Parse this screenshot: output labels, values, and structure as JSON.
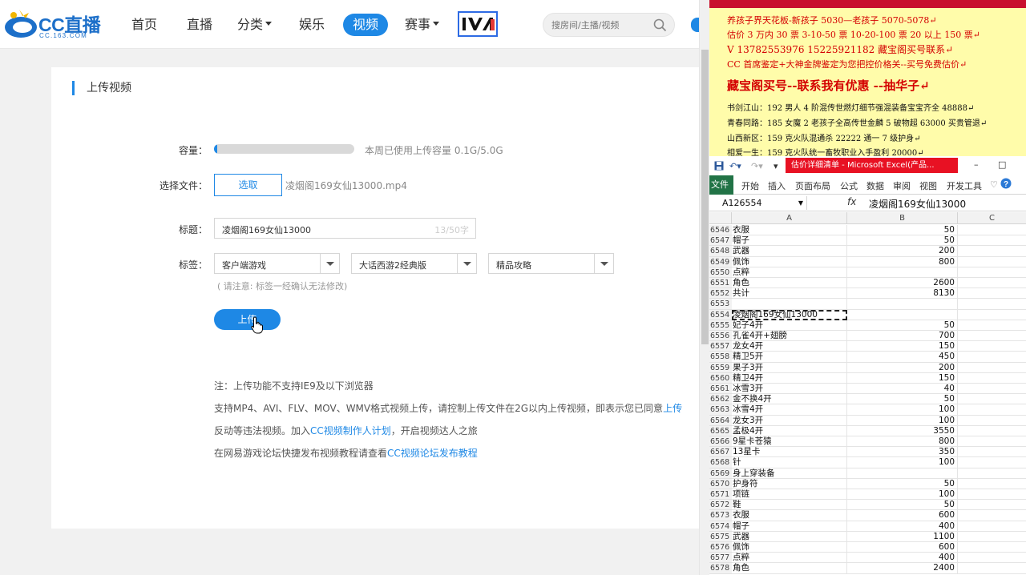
{
  "colors": {
    "brand": "#1e88e5",
    "excel_green": "#217346",
    "note_bg": "#fffcaa",
    "note_red": "#d40000",
    "excel_title_red": "#e81123"
  },
  "logo": {
    "text": "CC直播",
    "sub": "CC.163.COM"
  },
  "nav": {
    "items": [
      {
        "label": "首页"
      },
      {
        "label": "直播"
      },
      {
        "label": "分类",
        "caret": true
      },
      {
        "label": "娱乐"
      },
      {
        "label": "视频",
        "active": true
      },
      {
        "label": "赛事",
        "caret": true
      }
    ],
    "search_placeholder": "搜房间/主播/视频",
    "search_icon": "search-icon"
  },
  "upload": {
    "title": "上传视频",
    "capacity_label": "容量：",
    "capacity_fraction": 0.02,
    "capacity_text": "本周已使用上传容量 0.1G/5.0G",
    "file_label": "选择文件：",
    "choose_button": "选取",
    "file_name": "凌烟阁169女仙13000.mp4",
    "title_label": "标题：",
    "title_value": "凌烟阁169女仙13000",
    "title_count": "13/50字",
    "tag_label": "标签：",
    "tags": [
      "客户端游戏",
      "大话西游2经典版",
      "精品攻略"
    ],
    "tag_note": "( 请注意: 标签一经确认无法修改)",
    "upload_button": "上传",
    "notes": {
      "line1": "注：上传功能不支持IE9及以下浏览器",
      "line2_text": "支持MP4、AVI、FLV、MOV、WMV格式视频上传，请控制上传文件在2G以内上传视频，即表示您已同意",
      "line2_link": "上传",
      "line3_prefix": "反动等违法视频。加入",
      "line3_link": "CC视频制作人计划",
      "line3_suffix": "，开启视频达人之旅",
      "line4_prefix": "在网易游戏论坛快捷发布视频教程请查看",
      "line4_link": "CC视频论坛发布教程"
    }
  },
  "note_panel": {
    "lines": [
      {
        "style": "red",
        "text": "养孩子界天花板-新孩子 5030—老孩子 5070-5078↵"
      },
      {
        "style": "red",
        "text": "估价 3 万内 30 票    3-10-50 票    10-20-100 票    20 以上 150 票↵"
      },
      {
        "style": "red",
        "text": "V 13782553976     15225921182   藏宝阁买号联系↵"
      },
      {
        "style": "red",
        "text": "CC 首席鉴定+大神金牌鉴定为您把控价格关--买号免费估价↵"
      },
      {
        "style": "big",
        "text": "藏宝阁买号--联系我有优惠 --抽华子↵"
      },
      {
        "style": "blk",
        "text": "书剑江山：192 男人 4 阶混传世燃灯细节强混装备宝宝齐全 48888↵"
      },
      {
        "style": "blk",
        "text": "青春同路：185 女魔 2 老孩子全高传世金麟 5 破物超 63000 买贵管退↵"
      },
      {
        "style": "blk",
        "text": "山西新区：159 克火队混通杀 22222 通一 7 级护身↵"
      },
      {
        "style": "blk",
        "text": "相爱一生：159 克火队统一畜牧职业入手盈利 20000↵"
      }
    ]
  },
  "excel": {
    "title": "估价详细清单 - Microsoft Excel(产品...",
    "ribbon_tabs": [
      "文件",
      "开始",
      "插入",
      "页面布局",
      "公式",
      "数据",
      "审阅",
      "视图",
      "开发工具"
    ],
    "name_box": "A126554",
    "fx": "fx",
    "formula_value": "凌烟阁169女仙13000",
    "columns": [
      "A",
      "B",
      "C"
    ],
    "rows": [
      {
        "n": "6546",
        "a": "衣服",
        "b": "50"
      },
      {
        "n": "6547",
        "a": "帽子",
        "b": "50"
      },
      {
        "n": "6548",
        "a": "武器",
        "b": "200"
      },
      {
        "n": "6549",
        "a": "佩饰",
        "b": "800"
      },
      {
        "n": "6550",
        "a": "点粹",
        "b": ""
      },
      {
        "n": "6551",
        "a": "角色",
        "b": "2600"
      },
      {
        "n": "6552",
        "a": "共计",
        "b": "8130"
      },
      {
        "n": "6553",
        "a": "",
        "b": ""
      },
      {
        "n": "6554",
        "a": "凌烟阁169女仙13000",
        "b": "",
        "sel": true
      },
      {
        "n": "6555",
        "a": "妃子4开",
        "b": "50"
      },
      {
        "n": "6556",
        "a": "孔雀4开+翅膀",
        "b": "700"
      },
      {
        "n": "6557",
        "a": "龙女4开",
        "b": "150"
      },
      {
        "n": "6558",
        "a": "精卫5开",
        "b": "450"
      },
      {
        "n": "6559",
        "a": "果子3开",
        "b": "200"
      },
      {
        "n": "6560",
        "a": "精卫4开",
        "b": "150"
      },
      {
        "n": "6561",
        "a": "冰雪3开",
        "b": "40"
      },
      {
        "n": "6562",
        "a": "金不换4开",
        "b": "50"
      },
      {
        "n": "6563",
        "a": "冰雪4开",
        "b": "100"
      },
      {
        "n": "6564",
        "a": "龙女3开",
        "b": "100"
      },
      {
        "n": "6565",
        "a": "孟极4开",
        "b": "3550"
      },
      {
        "n": "6566",
        "a": "9星卡苍猿",
        "b": "800"
      },
      {
        "n": "6567",
        "a": "13星卡",
        "b": "350"
      },
      {
        "n": "6568",
        "a": "针",
        "b": "100"
      },
      {
        "n": "6569",
        "a": "身上穿装备",
        "b": ""
      },
      {
        "n": "6570",
        "a": "护身符",
        "b": "50"
      },
      {
        "n": "6571",
        "a": "项链",
        "b": "100"
      },
      {
        "n": "6572",
        "a": "鞋",
        "b": "50"
      },
      {
        "n": "6573",
        "a": "衣服",
        "b": "600"
      },
      {
        "n": "6574",
        "a": "帽子",
        "b": "400"
      },
      {
        "n": "6575",
        "a": "武器",
        "b": "1100"
      },
      {
        "n": "6576",
        "a": "佩饰",
        "b": "600"
      },
      {
        "n": "6577",
        "a": "点粹",
        "b": "400"
      },
      {
        "n": "6578",
        "a": "角色",
        "b": "2400"
      }
    ]
  }
}
